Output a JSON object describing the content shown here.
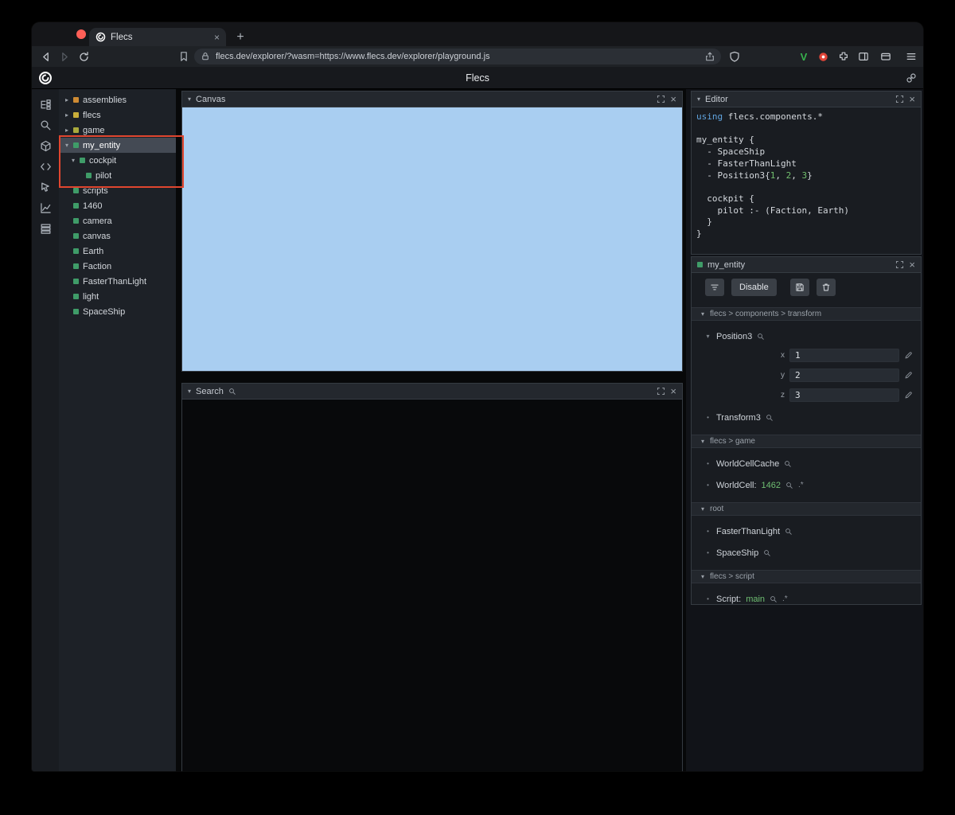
{
  "browser": {
    "tab": {
      "title": "Flecs"
    },
    "new_tab_label": "+",
    "url": "flecs.dev/explorer/?wasm=https://www.flecs.dev/explorer/playground.js"
  },
  "app": {
    "title": "Flecs"
  },
  "rail": {
    "icons": [
      "tree",
      "search",
      "entities",
      "code",
      "inspect",
      "stats",
      "memory"
    ]
  },
  "tree": {
    "items": [
      {
        "label": "assemblies",
        "color": "#cf8b33",
        "arrow": "collapsed",
        "indent": 0,
        "selected": false
      },
      {
        "label": "flecs",
        "color": "#c9ae3a",
        "arrow": "collapsed",
        "indent": 0,
        "selected": false
      },
      {
        "label": "game",
        "color": "#a9a93c",
        "arrow": "collapsed",
        "indent": 0,
        "selected": false
      },
      {
        "label": "my_entity",
        "color": "#3f9c68",
        "arrow": "expanded",
        "indent": 0,
        "selected": true
      },
      {
        "label": "cockpit",
        "color": "#3f9c68",
        "arrow": "expanded",
        "indent": 1,
        "selected": false
      },
      {
        "label": "pilot",
        "color": "#3f9c68",
        "arrow": "none",
        "indent": 2,
        "selected": false
      },
      {
        "label": "scripts",
        "color": "#3f9c68",
        "arrow": "none",
        "indent": 0,
        "selected": false
      },
      {
        "label": "1460",
        "color": "#3f9c68",
        "arrow": "none",
        "indent": 0,
        "selected": false
      },
      {
        "label": "camera",
        "color": "#3f9c68",
        "arrow": "none",
        "indent": 0,
        "selected": false
      },
      {
        "label": "canvas",
        "color": "#3f9c68",
        "arrow": "none",
        "indent": 0,
        "selected": false
      },
      {
        "label": "Earth",
        "color": "#3f9c68",
        "arrow": "none",
        "indent": 0,
        "selected": false
      },
      {
        "label": "Faction",
        "color": "#3f9c68",
        "arrow": "none",
        "indent": 0,
        "selected": false
      },
      {
        "label": "FasterThanLight",
        "color": "#3f9c68",
        "arrow": "none",
        "indent": 0,
        "selected": false
      },
      {
        "label": "light",
        "color": "#3f9c68",
        "arrow": "none",
        "indent": 0,
        "selected": false
      },
      {
        "label": "SpaceShip",
        "color": "#3f9c68",
        "arrow": "none",
        "indent": 0,
        "selected": false
      }
    ]
  },
  "panels": {
    "canvas": {
      "title": "Canvas"
    },
    "search": {
      "title": "Search"
    },
    "editor": {
      "title": "Editor"
    }
  },
  "editor": {
    "lines": [
      [
        [
          "kw",
          "using"
        ],
        [
          "plain",
          " flecs.components.*"
        ]
      ],
      [],
      [
        [
          "plain",
          "my_entity {"
        ]
      ],
      [
        [
          "plain",
          "  - SpaceShip"
        ]
      ],
      [
        [
          "plain",
          "  - FasterThanLight"
        ]
      ],
      [
        [
          "plain",
          "  - Position3{"
        ],
        [
          "num",
          "1"
        ],
        [
          "plain",
          ", "
        ],
        [
          "num",
          "2"
        ],
        [
          "plain",
          ", "
        ],
        [
          "num",
          "3"
        ],
        [
          "plain",
          "}"
        ]
      ],
      [],
      [
        [
          "plain",
          "  cockpit {"
        ]
      ],
      [
        [
          "plain",
          "    pilot :- (Faction, Earth)"
        ]
      ],
      [
        [
          "plain",
          "  }"
        ]
      ],
      [
        [
          "plain",
          "}"
        ]
      ]
    ]
  },
  "inspector": {
    "title": "my_entity",
    "buttons": {
      "disable": "Disable"
    },
    "sections": [
      {
        "path": "flecs > components > transform",
        "rows": [
          {
            "label": "Position3",
            "expanded": true,
            "fields": [
              {
                "key": "x",
                "value": "1"
              },
              {
                "key": "y",
                "value": "2"
              },
              {
                "key": "z",
                "value": "3"
              }
            ]
          },
          {
            "label": "Transform3"
          }
        ]
      },
      {
        "path": "flecs > game",
        "rows": [
          {
            "label": "WorldCellCache"
          },
          {
            "label": "WorldCell: ",
            "value": "1462",
            "suffix": ".*"
          }
        ]
      },
      {
        "path": "root",
        "rows": [
          {
            "label": "FasterThanLight"
          },
          {
            "label": "SpaceShip"
          }
        ]
      },
      {
        "path": "flecs > script",
        "rows": [
          {
            "label": "Script: ",
            "value": "main",
            "suffix": ".*"
          }
        ]
      }
    ]
  },
  "colors": {
    "canvas_bg": "#a9cef1",
    "accent_green": "#3f9c68",
    "annotation": "#e0462f"
  }
}
